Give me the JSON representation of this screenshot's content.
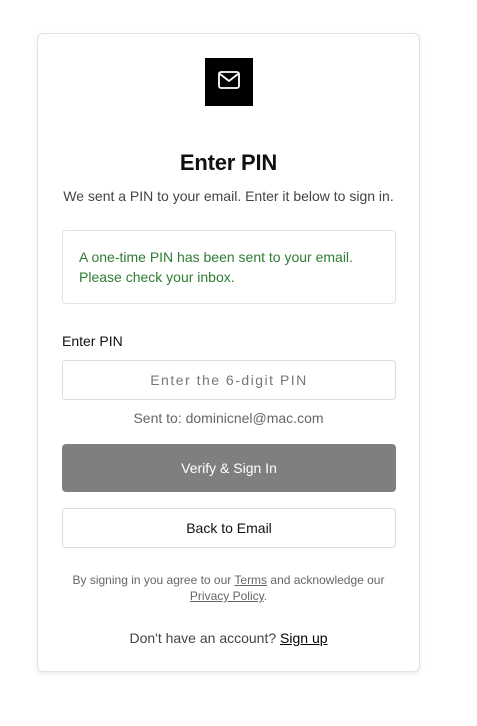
{
  "header": {
    "icon": "mail-icon",
    "title": "Enter PIN",
    "subtitle": "We sent a PIN to your email. Enter it below to sign in."
  },
  "notice": {
    "line1": "A one-time PIN has been sent to your email.",
    "line2": "Please check your inbox.",
    "color": "#2e7d32"
  },
  "form": {
    "pin_label": "Enter PIN",
    "pin_placeholder": "Enter the 6-digit PIN",
    "pin_value": "",
    "sent_to": "Sent to: dominicnel@mac.com",
    "verify_label": "Verify & Sign In",
    "back_label": "Back to Email"
  },
  "legal": {
    "prefix": "By signing in you agree to our ",
    "terms_link": "Terms",
    "middle": " and acknowledge our",
    "privacy_link": "Privacy Policy",
    "suffix": "."
  },
  "signup": {
    "prompt": "Don't have an account? ",
    "link": "Sign up"
  },
  "colors": {
    "accent": "#000000",
    "button_disabled": "#7f7f7f",
    "success_text": "#2e7d32"
  }
}
